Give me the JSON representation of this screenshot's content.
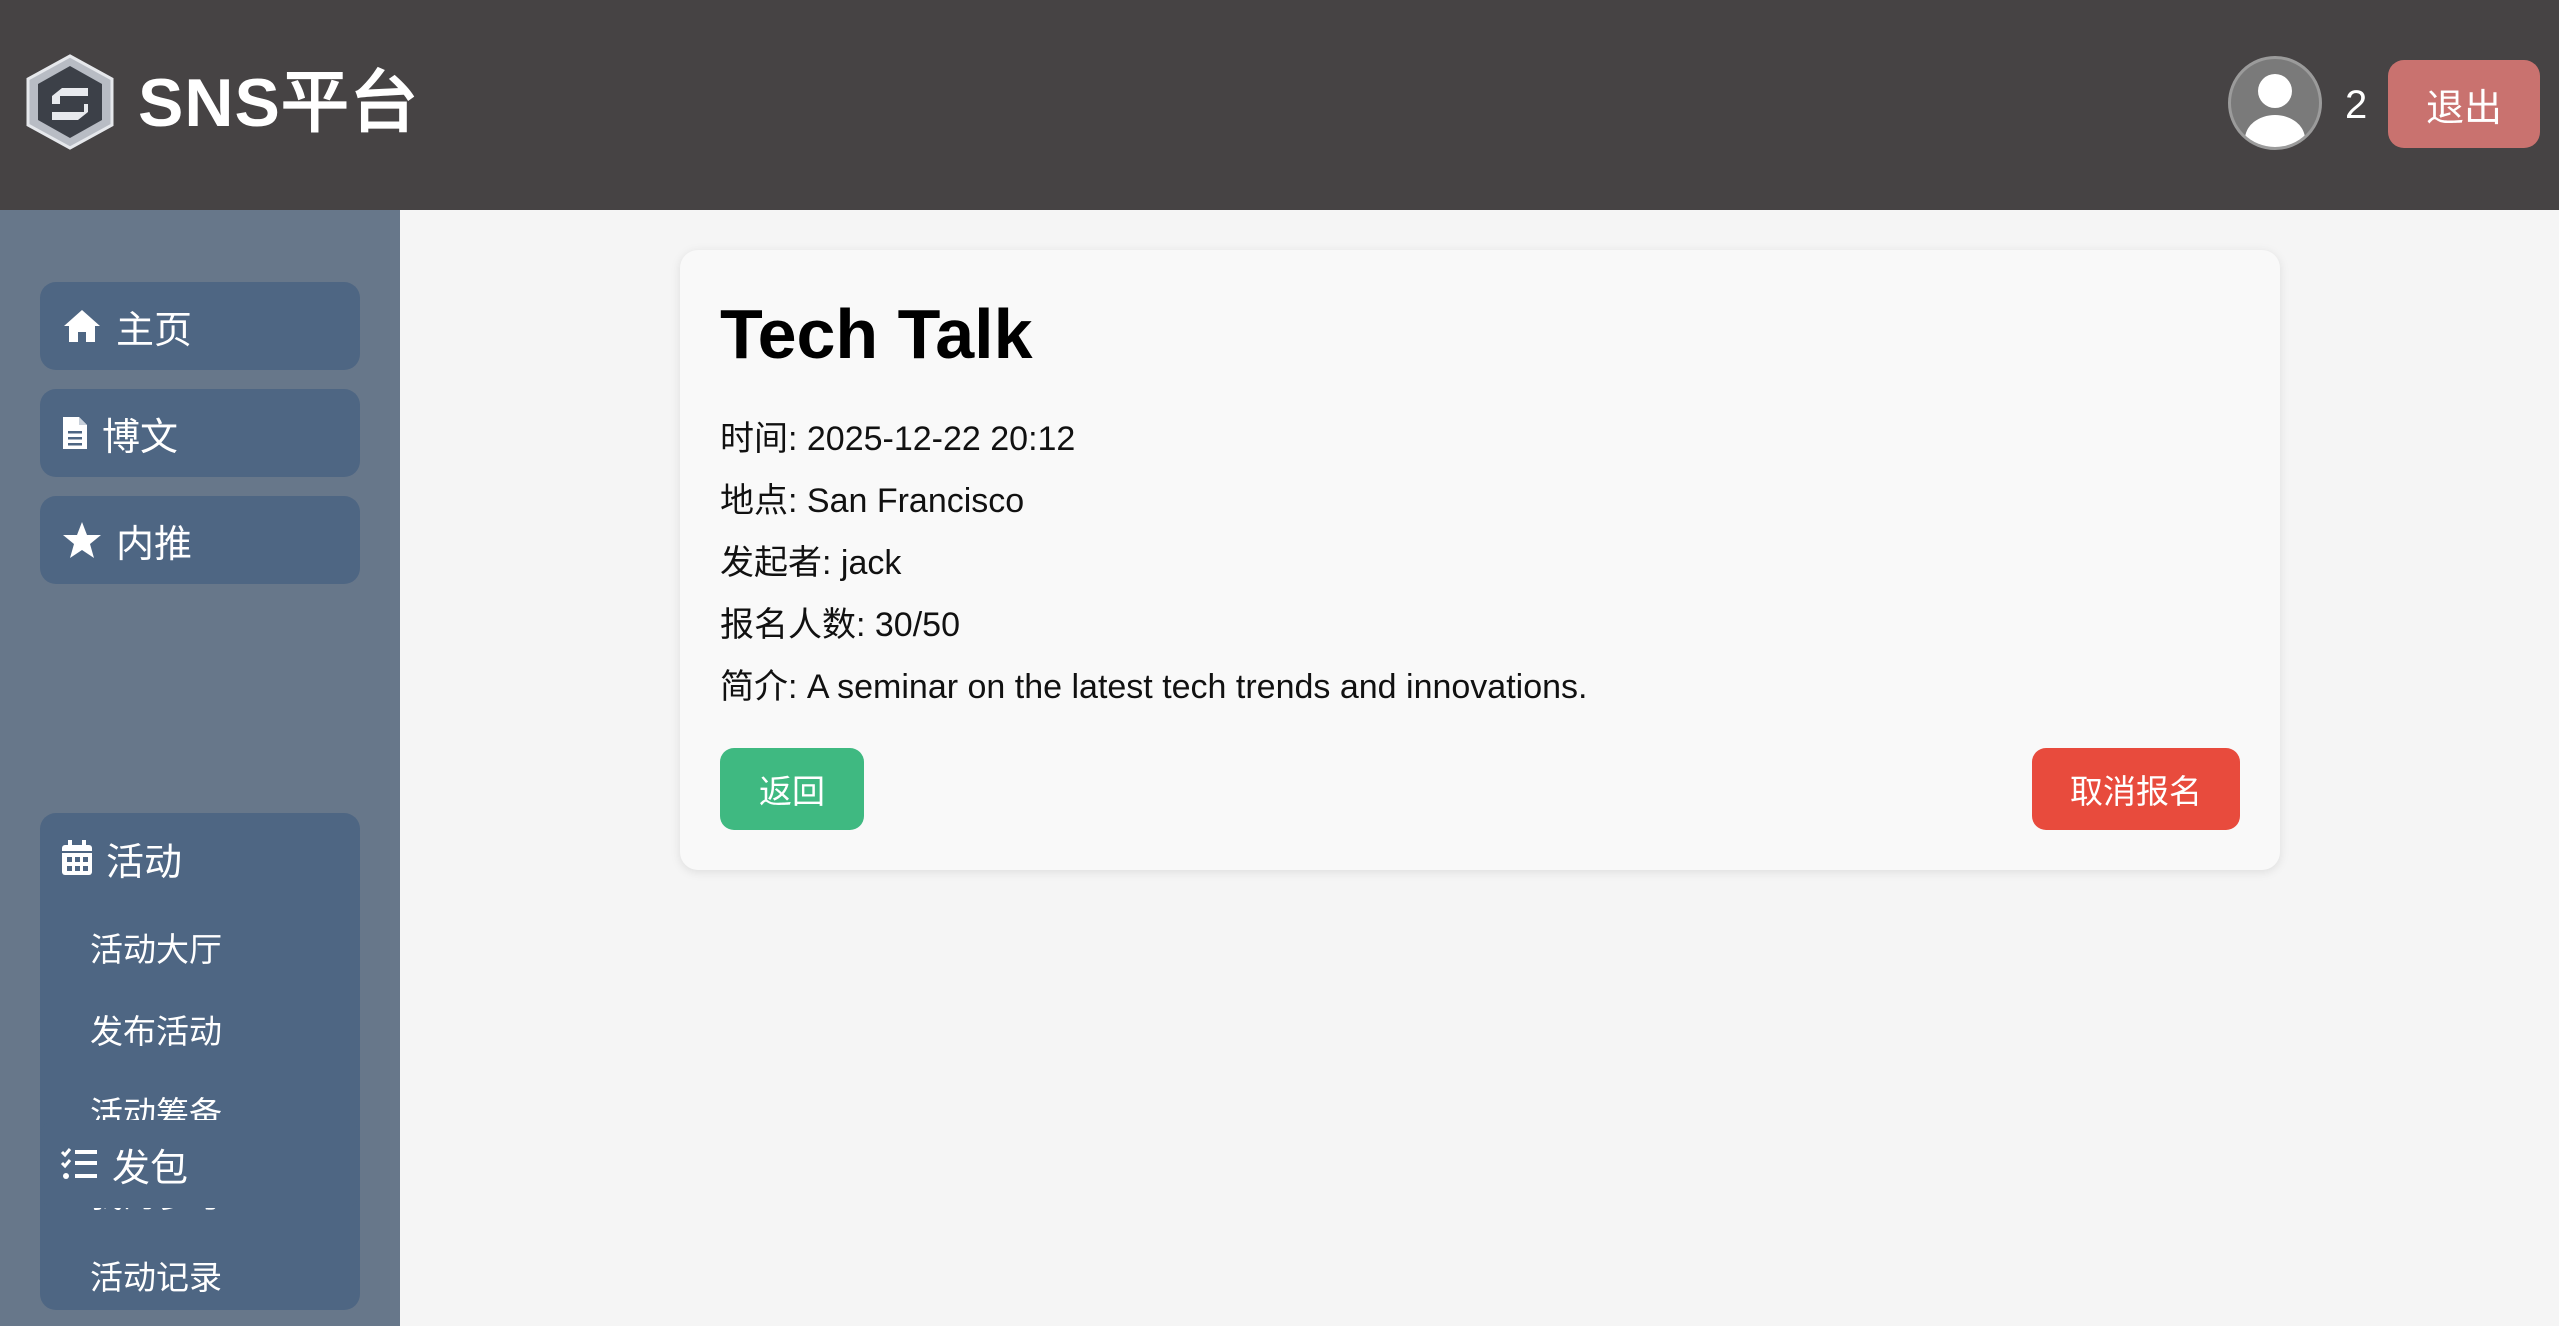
{
  "header": {
    "brand": "SNS平台",
    "user_count": "2",
    "logout_label": "退出",
    "logo_icon": "hexagon-s-logo-icon",
    "avatar_icon": "user-avatar-icon"
  },
  "sidebar": {
    "items": [
      {
        "label": "主页",
        "icon": "home-icon"
      },
      {
        "label": "博文",
        "icon": "document-icon"
      },
      {
        "label": "内推",
        "icon": "star-icon"
      }
    ],
    "activity": {
      "label": "活动",
      "icon": "calendar-icon",
      "subitems": [
        "活动大厅",
        "发布活动",
        "活动筹备",
        "我的参与",
        "活动记录"
      ]
    },
    "packet": {
      "label": "发包",
      "icon": "checklist-icon"
    }
  },
  "event": {
    "title": "Tech Talk",
    "time": "时间: 2025-12-22 20:12",
    "location": "地点: San Francisco",
    "organizer": "发起者: jack",
    "signups": "报名人数: 30/50",
    "summary": "简介: A seminar on the latest tech trends and innovations."
  },
  "actions": {
    "back_label": "返回",
    "cancel_label": "取消报名"
  },
  "colors": {
    "header_bg": "#464344",
    "sidebar_bg": "#67778a",
    "nav_item_bg": "#4e6683",
    "logout_bg": "#c9726f",
    "back_bg": "#3fb981",
    "cancel_bg": "#e84b3d"
  }
}
